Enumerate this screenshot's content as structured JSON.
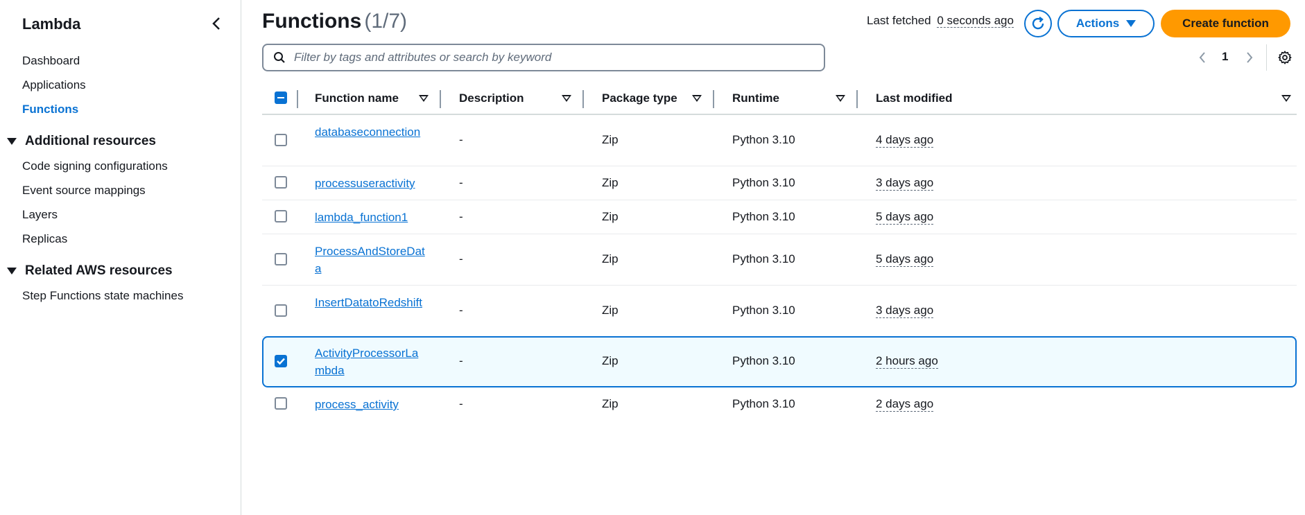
{
  "sidebar": {
    "title": "Lambda",
    "links": [
      "Dashboard",
      "Applications",
      "Functions"
    ],
    "active": "Functions",
    "sections": [
      {
        "title": "Additional resources",
        "items": [
          "Code signing configurations",
          "Event source mappings",
          "Layers",
          "Replicas"
        ]
      },
      {
        "title": "Related AWS resources",
        "items": [
          "Step Functions state machines"
        ]
      }
    ]
  },
  "header": {
    "title": "Functions",
    "count": "(1/7)",
    "last_fetched_label": "Last fetched",
    "last_fetched_value": "0 seconds ago",
    "actions_label": "Actions",
    "create_label": "Create function"
  },
  "search": {
    "placeholder": "Filter by tags and attributes or search by keyword",
    "value": ""
  },
  "pagination": {
    "current_page": "1"
  },
  "table": {
    "columns": [
      "Function name",
      "Description",
      "Package type",
      "Runtime",
      "Last modified"
    ],
    "rows": [
      {
        "name": "databaseconnection",
        "description": "-",
        "package": "Zip",
        "runtime": "Python 3.10",
        "modified": "4 days ago",
        "selected": false
      },
      {
        "name": "processuseractivity",
        "description": "-",
        "package": "Zip",
        "runtime": "Python 3.10",
        "modified": "3 days ago",
        "selected": false
      },
      {
        "name": "lambda_function1",
        "description": "-",
        "package": "Zip",
        "runtime": "Python 3.10",
        "modified": "5 days ago",
        "selected": false
      },
      {
        "name": "ProcessAndStoreData",
        "description": "-",
        "package": "Zip",
        "runtime": "Python 3.10",
        "modified": "5 days ago",
        "selected": false
      },
      {
        "name": "InsertDatatoRedshift",
        "description": "-",
        "package": "Zip",
        "runtime": "Python 3.10",
        "modified": "3 days ago",
        "selected": false
      },
      {
        "name": "ActivityProcessorLambda",
        "description": "-",
        "package": "Zip",
        "runtime": "Python 3.10",
        "modified": "2 hours ago",
        "selected": true
      },
      {
        "name": "process_activity",
        "description": "-",
        "package": "Zip",
        "runtime": "Python 3.10",
        "modified": "2 days ago",
        "selected": false
      }
    ]
  },
  "colors": {
    "accent": "#0972d3",
    "primary_button": "#ff9900",
    "selected_row_bg": "#f0fbff"
  },
  "icons": [
    "chevron-left-icon",
    "caret-down-icon",
    "refresh-icon",
    "search-icon",
    "chevron-right-icon",
    "gear-icon",
    "sort-icon"
  ]
}
